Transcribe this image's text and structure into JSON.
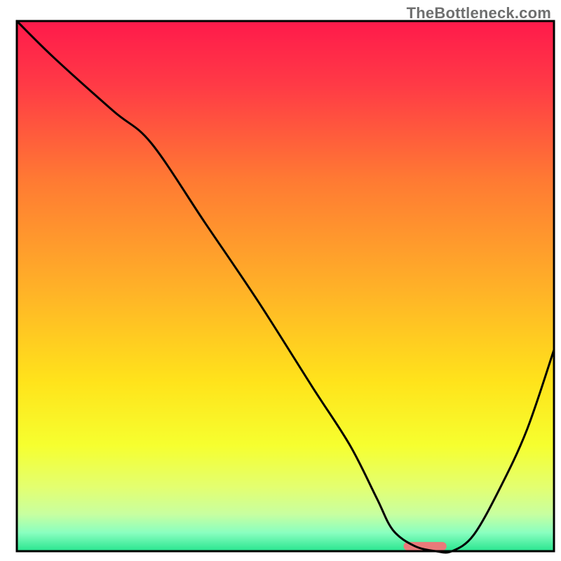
{
  "watermark": "TheBottleneck.com",
  "chart_data": {
    "type": "line",
    "title": "",
    "xlabel": "",
    "ylabel": "",
    "xlim": [
      0,
      100
    ],
    "ylim": [
      0,
      100
    ],
    "grid": false,
    "legend": false,
    "background": {
      "kind": "vertical-gradient",
      "stops": [
        {
          "pos": 0.0,
          "color": "#ff1a4b"
        },
        {
          "pos": 0.12,
          "color": "#ff3a46"
        },
        {
          "pos": 0.3,
          "color": "#ff7a33"
        },
        {
          "pos": 0.5,
          "color": "#ffb028"
        },
        {
          "pos": 0.68,
          "color": "#ffe31b"
        },
        {
          "pos": 0.8,
          "color": "#f6ff2f"
        },
        {
          "pos": 0.88,
          "color": "#e3ff71"
        },
        {
          "pos": 0.93,
          "color": "#c8ffa0"
        },
        {
          "pos": 0.965,
          "color": "#8affc0"
        },
        {
          "pos": 1.0,
          "color": "#28e58f"
        }
      ]
    },
    "series": [
      {
        "name": "curve",
        "color": "#000000",
        "x": [
          0,
          7,
          18,
          25,
          35,
          45,
          55,
          62,
          67,
          70,
          74,
          78,
          81,
          85,
          90,
          95,
          100
        ],
        "y": [
          100,
          93,
          83,
          77,
          62,
          47,
          31,
          20,
          10,
          4,
          1,
          0,
          0,
          3,
          12,
          23,
          38
        ]
      }
    ],
    "marker": {
      "name": "optimum-marker",
      "shape": "rounded-rect",
      "color": "#e97a7a",
      "xrange": [
        72,
        80
      ],
      "y": 0,
      "thickness_pct": 1.6
    },
    "frame": {
      "color": "#000000",
      "width": 3
    }
  }
}
